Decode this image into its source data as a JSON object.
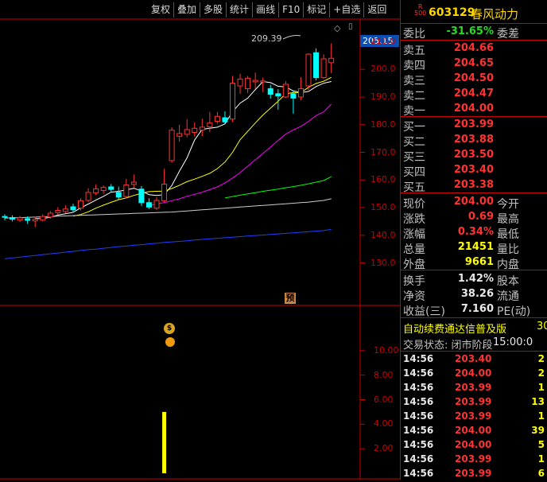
{
  "toolbar": {
    "buttons": [
      "复权",
      "叠加",
      "多股",
      "统计",
      "画线",
      "F10",
      "标记",
      "+自选",
      "返回"
    ]
  },
  "chart": {
    "current_price_flag": "205.15",
    "peak_label": "209.39",
    "yu_badge": "预",
    "moneybag_glyph": "$",
    "price_ticks": [
      "210.0",
      "200.0",
      "190.0",
      "180.0",
      "170.0",
      "160.0",
      "150.0",
      "140.0",
      "130.0"
    ],
    "volume_ticks": [
      "10.00",
      "8.00",
      "6.00",
      "4.00",
      "2.00"
    ],
    "colors": {
      "up": "#ff3232",
      "down": "#00ffff",
      "ma5": "#ffffff",
      "ma10": "#ffff00",
      "ma20": "#ff00ff",
      "ma30": "#00ff00",
      "ma60": "#cccccc",
      "ma120": "#1f3fff",
      "volume": "#ffff00"
    }
  },
  "panel": {
    "rank": "R\n500",
    "code": "603129",
    "name": "春风动力",
    "weibi": {
      "label": "委比",
      "value": "-31.65%",
      "label2": "委差"
    },
    "sells": [
      {
        "label": "卖五",
        "price": "204.66"
      },
      {
        "label": "卖四",
        "price": "204.65"
      },
      {
        "label": "卖三",
        "price": "204.50"
      },
      {
        "label": "卖二",
        "price": "204.47"
      },
      {
        "label": "卖一",
        "price": "204.00"
      }
    ],
    "buys": [
      {
        "label": "买一",
        "price": "203.99"
      },
      {
        "label": "买二",
        "price": "203.88"
      },
      {
        "label": "买三",
        "price": "203.50"
      },
      {
        "label": "买四",
        "price": "203.40"
      },
      {
        "label": "买五",
        "price": "203.38"
      }
    ],
    "quote": [
      {
        "label": "现价",
        "value": "204.00",
        "label2": "今开",
        "cls": "red"
      },
      {
        "label": "涨跌",
        "value": "0.69",
        "label2": "最高",
        "cls": "red"
      },
      {
        "label": "涨幅",
        "value": "0.34%",
        "label2": "最低",
        "cls": "red"
      },
      {
        "label": "总量",
        "value": "21451",
        "label2": "量比",
        "cls": "yellow"
      },
      {
        "label": "外盘",
        "value": "9661",
        "label2": "内盘",
        "cls": "yellow"
      }
    ],
    "fund": [
      {
        "label": "换手",
        "value": "1.42%",
        "label2": "股本",
        "cls": "white"
      },
      {
        "label": "净资",
        "value": "38.26",
        "label2": "流通",
        "cls": "white"
      },
      {
        "label": "收益(三)",
        "value": "7.160",
        "label2": "PE(动)",
        "cls": "white"
      }
    ],
    "info_line1": {
      "text": "自动续费通达信普及版",
      "right": "30"
    },
    "info_line2": {
      "text": "交易状态: 闭市阶段",
      "time": "15:00:0"
    },
    "trades": [
      {
        "time": "14:56",
        "price": "203.40",
        "qty": "2",
        "cls": "red"
      },
      {
        "time": "14:56",
        "price": "204.00",
        "qty": "2",
        "cls": "red"
      },
      {
        "time": "14:56",
        "price": "203.99",
        "qty": "1",
        "cls": "red"
      },
      {
        "time": "14:56",
        "price": "203.99",
        "qty": "13",
        "cls": "red"
      },
      {
        "time": "14:56",
        "price": "203.99",
        "qty": "1",
        "cls": "red"
      },
      {
        "time": "14:56",
        "price": "204.00",
        "qty": "39",
        "cls": "red"
      },
      {
        "time": "14:56",
        "price": "204.00",
        "qty": "5",
        "cls": "red"
      },
      {
        "time": "14:56",
        "price": "203.99",
        "qty": "1",
        "cls": "red"
      },
      {
        "time": "14:56",
        "price": "203.99",
        "qty": "6",
        "cls": "red"
      }
    ]
  },
  "chart_data": {
    "type": "candlestick",
    "ylim": [
      127,
      213
    ],
    "volume_ylim": [
      0,
      12
    ],
    "candles": [
      {
        "o": 146.8,
        "c": 146.5,
        "h": 147.6,
        "l": 145.4
      },
      {
        "o": 146.4,
        "c": 145.8,
        "h": 147.2,
        "l": 145.0
      },
      {
        "o": 145.5,
        "c": 146.3,
        "h": 147.0,
        "l": 144.8
      },
      {
        "o": 146.0,
        "c": 145.4,
        "h": 146.8,
        "l": 144.2
      },
      {
        "o": 145.2,
        "c": 145.8,
        "h": 146.7,
        "l": 143.0
      },
      {
        "o": 145.5,
        "c": 146.8,
        "h": 147.6,
        "l": 145.0
      },
      {
        "o": 146.6,
        "c": 148.0,
        "h": 148.8,
        "l": 146.0
      },
      {
        "o": 148.2,
        "c": 149.0,
        "h": 150.2,
        "l": 147.4
      },
      {
        "o": 148.6,
        "c": 149.5,
        "h": 150.8,
        "l": 148.0
      },
      {
        "o": 150.3,
        "c": 149.2,
        "h": 151.4,
        "l": 148.6
      },
      {
        "o": 149.8,
        "c": 152.5,
        "h": 153.4,
        "l": 149.0
      },
      {
        "o": 152.6,
        "c": 155.5,
        "h": 157.0,
        "l": 152.0
      },
      {
        "o": 155.3,
        "c": 156.8,
        "h": 158.4,
        "l": 154.6
      },
      {
        "o": 156.2,
        "c": 157.3,
        "h": 158.0,
        "l": 155.0
      },
      {
        "o": 157.5,
        "c": 156.6,
        "h": 158.5,
        "l": 155.8
      },
      {
        "o": 155.5,
        "c": 153.8,
        "h": 157.6,
        "l": 153.0
      },
      {
        "o": 154.0,
        "c": 158.2,
        "h": 160.4,
        "l": 153.4
      },
      {
        "o": 158.4,
        "c": 159.2,
        "h": 162.0,
        "l": 157.3
      },
      {
        "o": 156.7,
        "c": 151.8,
        "h": 157.8,
        "l": 150.6
      },
      {
        "o": 151.8,
        "c": 150.2,
        "h": 153.4,
        "l": 149.5
      },
      {
        "o": 149.8,
        "c": 152.6,
        "h": 153.8,
        "l": 149.2
      },
      {
        "o": 152.5,
        "c": 158.5,
        "h": 164.0,
        "l": 152.0
      },
      {
        "o": 167.0,
        "c": 178.0,
        "h": 179.0,
        "l": 166.2
      },
      {
        "o": 175.8,
        "c": 176.8,
        "h": 180.0,
        "l": 173.8
      },
      {
        "o": 176.5,
        "c": 178.2,
        "h": 182.0,
        "l": 175.4
      },
      {
        "o": 177.2,
        "c": 178.7,
        "h": 180.8,
        "l": 175.6
      },
      {
        "o": 178.0,
        "c": 179.1,
        "h": 182.2,
        "l": 175.8
      },
      {
        "o": 179.2,
        "c": 180.6,
        "h": 184.6,
        "l": 177.3
      },
      {
        "o": 181.2,
        "c": 183.0,
        "h": 184.6,
        "l": 180.4
      },
      {
        "o": 182.5,
        "c": 181.0,
        "h": 184.8,
        "l": 180.4
      },
      {
        "o": 182.0,
        "c": 195.0,
        "h": 197.6,
        "l": 181.0
      },
      {
        "o": 194.0,
        "c": 196.5,
        "h": 198.4,
        "l": 191.2
      },
      {
        "o": 193.0,
        "c": 196.8,
        "h": 197.6,
        "l": 191.4
      },
      {
        "o": 195.5,
        "c": 196.0,
        "h": 198.8,
        "l": 193.0
      },
      {
        "o": 195.4,
        "c": 195.8,
        "h": 197.0,
        "l": 191.8
      },
      {
        "o": 193.0,
        "c": 191.0,
        "h": 194.4,
        "l": 189.4
      },
      {
        "o": 191.2,
        "c": 190.4,
        "h": 192.8,
        "l": 185.4
      },
      {
        "o": 190.0,
        "c": 194.6,
        "h": 195.8,
        "l": 189.6
      },
      {
        "o": 191.2,
        "c": 189.6,
        "h": 192.2,
        "l": 184.0
      },
      {
        "o": 190.0,
        "c": 193.0,
        "h": 197.2,
        "l": 188.8
      },
      {
        "o": 194.0,
        "c": 205.5,
        "h": 205.8,
        "l": 192.4
      },
      {
        "o": 206.0,
        "c": 197.0,
        "h": 207.6,
        "l": 196.0
      },
      {
        "o": 197.0,
        "c": 203.8,
        "h": 205.4,
        "l": 196.6
      },
      {
        "o": 202.4,
        "c": 204.0,
        "h": 209.4,
        "l": 198.6
      }
    ],
    "ma": [
      {
        "name": "ma5",
        "values": [
          null,
          null,
          null,
          null,
          146.0,
          146.1,
          146.5,
          147.3,
          147.8,
          148.3,
          149.9,
          151.3,
          152.7,
          154.1,
          155.6,
          155.9,
          156.4,
          157.0,
          156.0,
          154.7,
          154.4,
          154.7,
          158.0,
          163.2,
          168.0,
          174.5,
          178.3,
          178.7,
          179.1,
          180.3,
          184.7,
          187.8,
          189.6,
          192.7,
          195.6,
          195.2,
          193.9,
          193.6,
          192.2,
          191.6,
          192.0,
          193.8,
          195.0,
          195.6
        ]
      },
      {
        "name": "ma10",
        "values": [
          null,
          null,
          null,
          null,
          null,
          null,
          null,
          null,
          null,
          146.9,
          147.5,
          148.5,
          149.8,
          150.9,
          151.9,
          152.9,
          153.5,
          154.4,
          155.2,
          155.8,
          155.9,
          156.0,
          156.9,
          158.1,
          159.4,
          160.3,
          161.3,
          162.4,
          164.1,
          166.5,
          170.0,
          174.6,
          177.6,
          180.6,
          183.5,
          186.0,
          188.5,
          191.2,
          191.6,
          191.6,
          193.5,
          194.9,
          195.7,
          197.1
        ]
      },
      {
        "name": "ma20",
        "values": [
          null,
          null,
          null,
          null,
          null,
          null,
          null,
          null,
          null,
          null,
          null,
          null,
          null,
          null,
          null,
          null,
          null,
          null,
          null,
          150.8,
          151.4,
          151.8,
          152.5,
          153.2,
          154.1,
          154.8,
          155.6,
          156.5,
          157.5,
          158.9,
          160.7,
          162.7,
          165.0,
          167.3,
          169.6,
          171.9,
          174.3,
          176.6,
          178.1,
          179.4,
          181.2,
          183.3,
          184.6,
          187.4
        ]
      },
      {
        "name": "ma30",
        "values": [
          null,
          null,
          null,
          null,
          null,
          null,
          null,
          null,
          null,
          null,
          null,
          null,
          null,
          null,
          null,
          null,
          null,
          null,
          null,
          null,
          null,
          null,
          null,
          null,
          null,
          null,
          null,
          null,
          null,
          153.5,
          154.0,
          154.5,
          155.0,
          155.4,
          155.9,
          156.3,
          156.7,
          157.2,
          157.6,
          158.1,
          158.6,
          159.2,
          159.8,
          161.2
        ]
      },
      {
        "name": "ma60",
        "values": [
          146.2,
          146.3,
          146.4,
          146.5,
          146.6,
          146.7,
          146.8,
          146.9,
          147.0,
          147.1,
          147.2,
          147.3,
          147.4,
          147.5,
          147.6,
          147.7,
          147.8,
          147.9,
          148.0,
          148.1,
          148.2,
          148.3,
          148.4,
          148.6,
          148.8,
          149.0,
          149.2,
          149.4,
          149.6,
          149.8,
          150.0,
          150.2,
          150.4,
          150.6,
          150.8,
          151.0,
          151.2,
          151.4,
          151.6,
          151.8,
          152.0,
          152.3,
          152.6,
          153.2
        ]
      },
      {
        "name": "ma120",
        "values": [
          131.5,
          131.8,
          132.1,
          132.4,
          132.7,
          133.0,
          133.3,
          133.6,
          133.9,
          134.2,
          134.5,
          134.8,
          135.0,
          135.3,
          135.6,
          135.9,
          136.1,
          136.4,
          136.6,
          136.9,
          137.1,
          137.4,
          137.6,
          137.8,
          138.0,
          138.3,
          138.5,
          138.7,
          138.9,
          139.1,
          139.3,
          139.5,
          139.7,
          139.9,
          140.1,
          140.3,
          140.5,
          140.7,
          140.9,
          141.1,
          141.3,
          141.5,
          141.7,
          142.2
        ]
      }
    ],
    "volume_bars": [
      {
        "index": 21,
        "value": 5.0
      }
    ]
  }
}
